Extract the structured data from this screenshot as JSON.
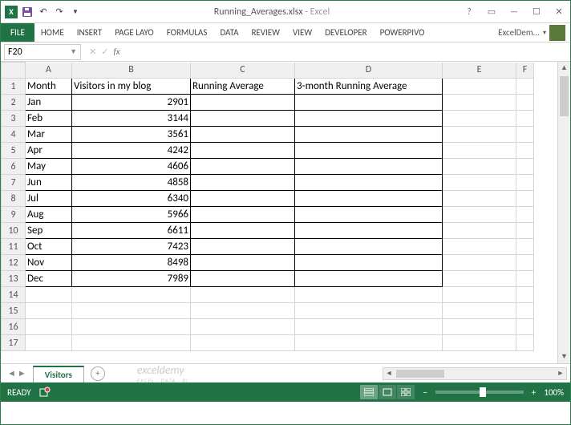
{
  "titlebar": {
    "filename": "Running_Averages.xlsx",
    "appname": "Excel"
  },
  "ribbon": {
    "file": "FILE",
    "tabs": [
      "HOME",
      "INSERT",
      "PAGE LAYO",
      "FORMULAS",
      "DATA",
      "REVIEW",
      "VIEW",
      "DEVELOPER",
      "POWERPIVO"
    ],
    "user": "ExcelDem..."
  },
  "formula": {
    "namebox": "F20",
    "fx": "fx",
    "value": ""
  },
  "columns": [
    "A",
    "B",
    "C",
    "D",
    "E",
    "F"
  ],
  "headers": {
    "A": "Month",
    "B": "Visitors in my blog",
    "C": "Running Average",
    "D": "3-month Running Average"
  },
  "rows": [
    {
      "n": 2,
      "A": "Jan",
      "B": "2901"
    },
    {
      "n": 3,
      "A": "Feb",
      "B": "3144"
    },
    {
      "n": 4,
      "A": "Mar",
      "B": "3561"
    },
    {
      "n": 5,
      "A": "Apr",
      "B": "4242"
    },
    {
      "n": 6,
      "A": "May",
      "B": "4606"
    },
    {
      "n": 7,
      "A": "Jun",
      "B": "4858"
    },
    {
      "n": 8,
      "A": "Jul",
      "B": "6340"
    },
    {
      "n": 9,
      "A": "Aug",
      "B": "5966"
    },
    {
      "n": 10,
      "A": "Sep",
      "B": "6611"
    },
    {
      "n": 11,
      "A": "Oct",
      "B": "7423"
    },
    {
      "n": 12,
      "A": "Nov",
      "B": "8498"
    },
    {
      "n": 13,
      "A": "Dec",
      "B": "7989"
    }
  ],
  "empty_rows": [
    14,
    15,
    16,
    17
  ],
  "sheet": {
    "active": "Visitors"
  },
  "watermark": "exceldemy",
  "watermark_sub": "EXCEL · DATA · BI",
  "status": {
    "ready": "READY",
    "zoom": "100%"
  }
}
